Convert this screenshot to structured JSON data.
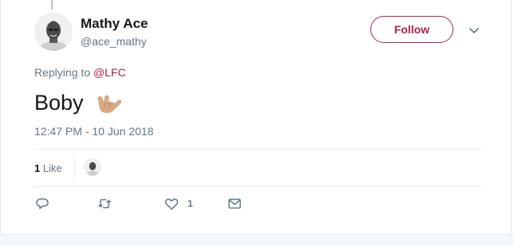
{
  "tweet": {
    "author": {
      "name": "Mathy Ace",
      "handle": "@ace_mathy",
      "avatar_icon": "profile-photo-icon"
    },
    "follow_label": "Follow",
    "menu_icon": "chevron-down-icon",
    "replying_prefix": "Replying to",
    "replying_to": "@LFC",
    "text": "Boby",
    "emoji_icon": "call-me-hand-emoji",
    "timestamp": "12:47 PM - 10 Jun 2018",
    "stats": {
      "likes_count": "1",
      "likes_label": "Like"
    },
    "actions": {
      "reply_icon": "reply-icon",
      "retweet_icon": "retweet-icon",
      "like_icon": "heart-icon",
      "like_count": "1",
      "dm_icon": "envelope-icon"
    }
  },
  "colors": {
    "accent": "#b0224c",
    "muted": "#657786",
    "text": "#14171a",
    "border": "#e6ecf0"
  }
}
